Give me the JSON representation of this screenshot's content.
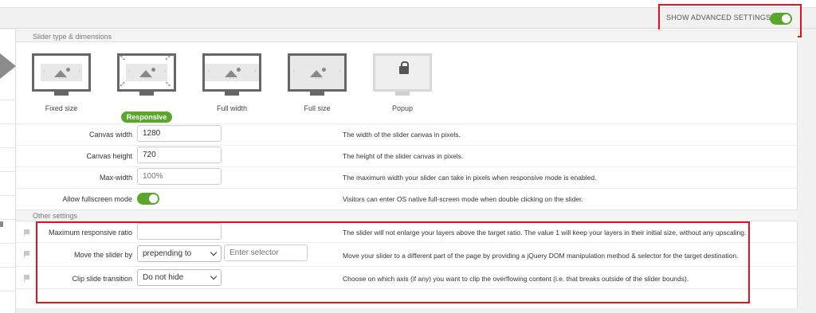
{
  "header": {
    "advanced_label": "SHOW ADVANCED SETTINGS",
    "advanced_toggle_on": true
  },
  "sections": {
    "type_dimensions": "Slider type & dimensions",
    "other": "Other settings"
  },
  "slider_types": [
    {
      "label": "Fixed size",
      "icon": "monitor-fixed-icon",
      "active": false
    },
    {
      "label": "Responsive",
      "icon": "monitor-responsive-icon",
      "active": true
    },
    {
      "label": "Full width",
      "icon": "monitor-fullwidth-icon",
      "active": false
    },
    {
      "label": "Full size",
      "icon": "monitor-fullsize-icon",
      "active": false
    },
    {
      "label": "Popup",
      "icon": "monitor-popup-lock-icon",
      "active": false
    }
  ],
  "fields": {
    "canvas_width": {
      "label": "Canvas width",
      "value": "1280",
      "desc": "The width of the slider canvas in pixels."
    },
    "canvas_height": {
      "label": "Canvas height",
      "value": "720",
      "desc": "The height of the slider canvas in pixels."
    },
    "max_width": {
      "label": "Max-width",
      "placeholder": "100%",
      "desc": "The maximum width your slider can take in pixels when responsive mode is enabled."
    },
    "fullscreen": {
      "label": "Allow fullscreen mode",
      "on": true,
      "desc": "Visitors can enter OS native full-screen mode when double clicking on the slider."
    },
    "max_ratio": {
      "label": "Maximum responsive ratio",
      "value": "",
      "desc": "The slider will not enlarge your layers above the target ratio. The value 1 will keep your layers in their initial size, without any upscaling."
    },
    "move_slider": {
      "label": "Move the slider by",
      "selected": "prepending to",
      "selector_placeholder": "Enter selector",
      "desc": "Move your slider to a different part of the page by providing a jQuery DOM manipulation method & selector for the target destination."
    },
    "clip_transition": {
      "label": "Clip slide transition",
      "selected": "Do not hide",
      "desc": "Choose on which axis (if any) you want to clip the overflowing content (i.e. that breaks outside of the slider bounds)."
    }
  },
  "colors": {
    "accent_green": "#5ba72e",
    "highlight_red": "#e0141e"
  }
}
